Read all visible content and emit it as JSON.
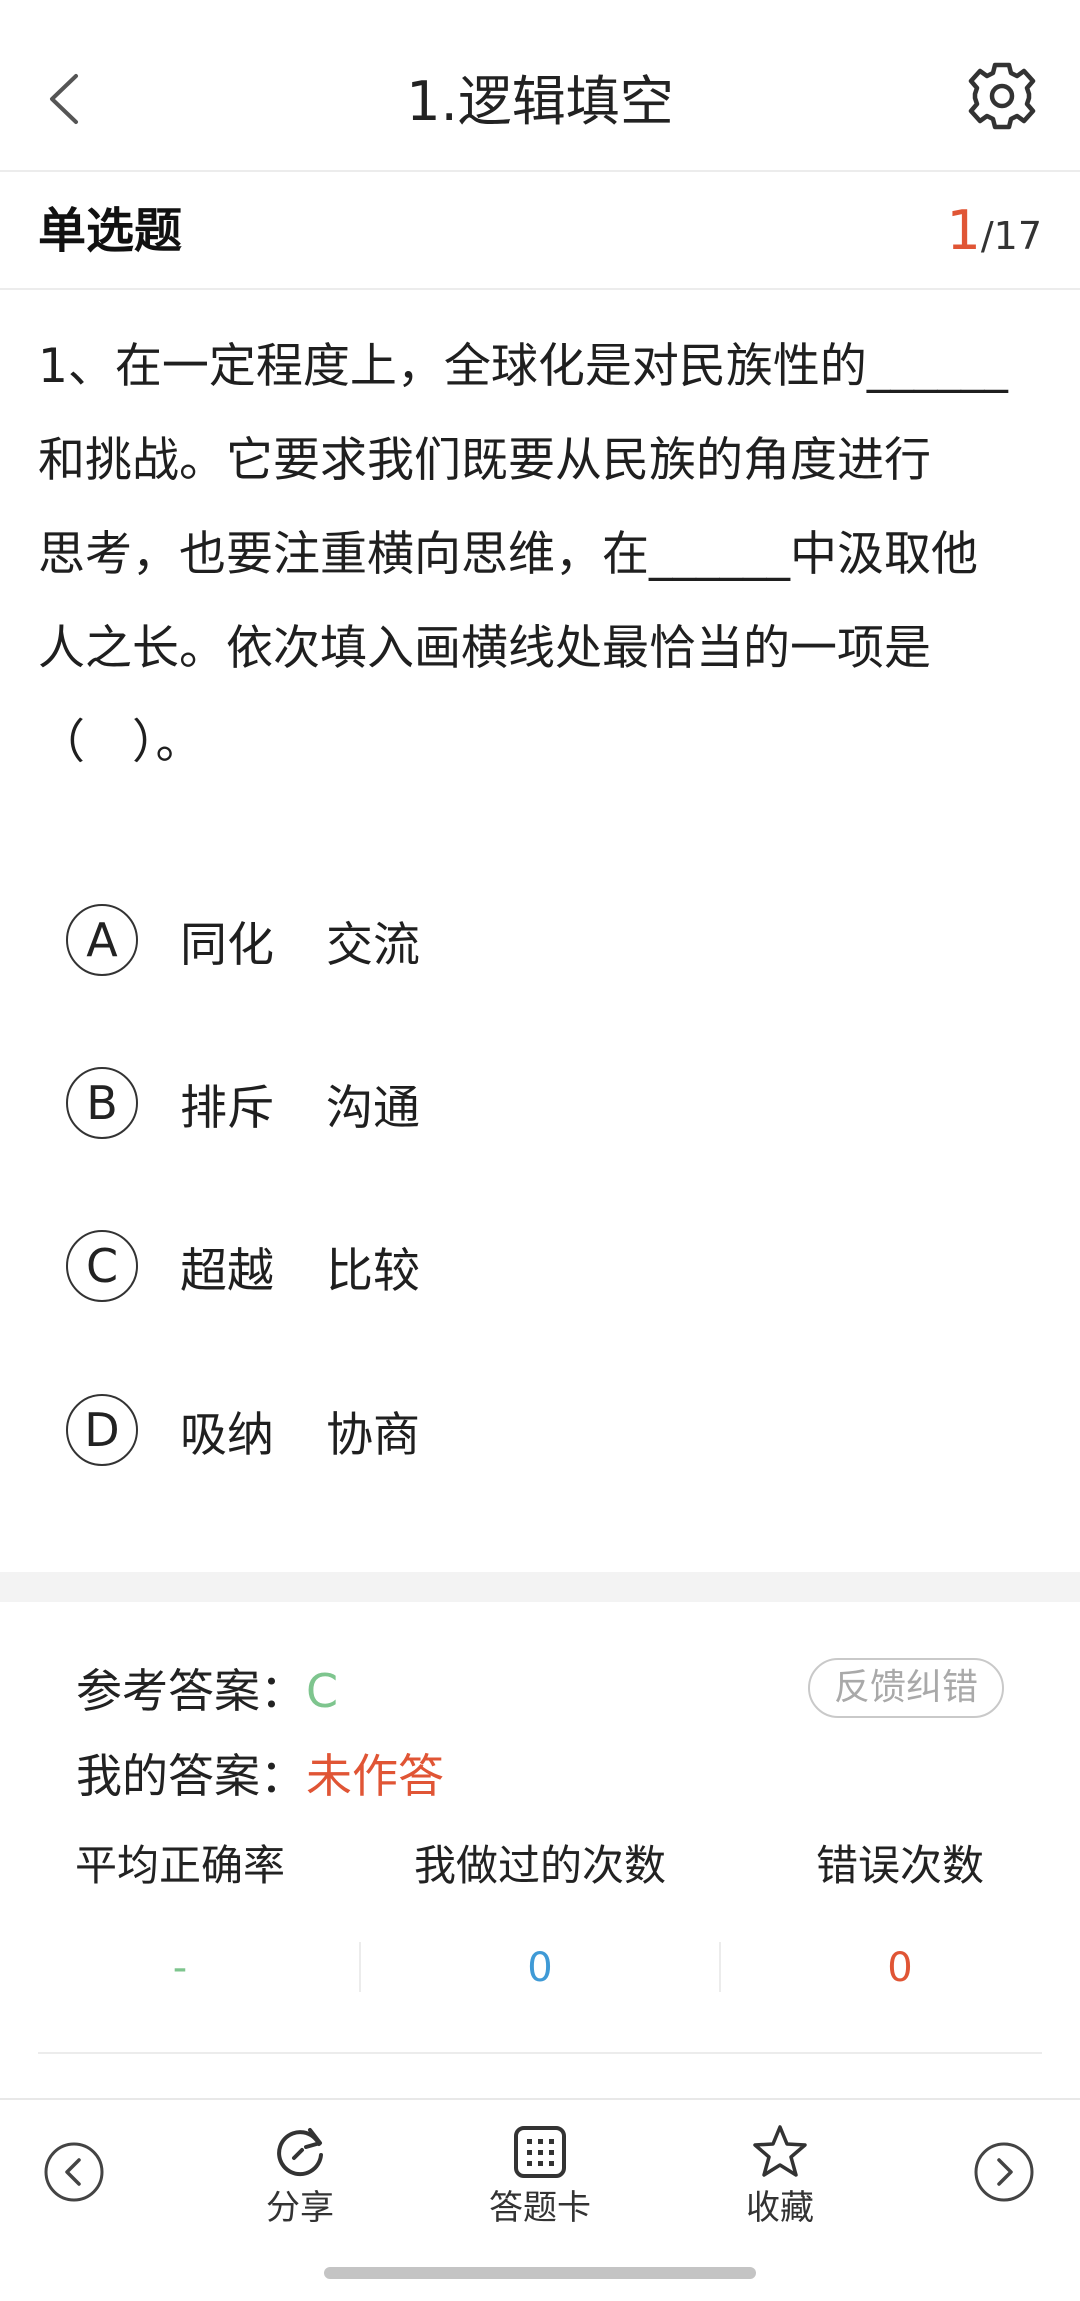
{
  "header": {
    "title": "1.逻辑填空"
  },
  "question_bar": {
    "type_label": "单选题",
    "current": "1",
    "total": "/17"
  },
  "question": {
    "line1": "1、在一定程度上，全球化是对民族性的______",
    "line2": "和挑战。它要求我们既要从民族的角度进行",
    "line3": "思考，也要注重横向思维，在______中汲取他",
    "line4": "人之长。依次填入画横线处最恰当的一项是",
    "line5": "（　）。"
  },
  "options": [
    {
      "letter": "A",
      "word1": "同化",
      "word2": "交流"
    },
    {
      "letter": "B",
      "word1": "排斥",
      "word2": "沟通"
    },
    {
      "letter": "C",
      "word1": "超越",
      "word2": "比较"
    },
    {
      "letter": "D",
      "word1": "吸纳",
      "word2": "协商"
    }
  ],
  "answer": {
    "ref_label": "参考答案：",
    "ref_value": "C",
    "my_label": "我的答案：",
    "my_value": "未作答",
    "feedback_label": "反馈纠错"
  },
  "stats": {
    "headers": [
      "平均正确率",
      "我做过的次数",
      "错误次数"
    ],
    "values": [
      "-",
      "0",
      "0"
    ],
    "colors": [
      "#7ec58e",
      "#3f9ad6",
      "#e05535"
    ]
  },
  "toolbar": {
    "share_label": "分享",
    "card_label": "答题卡",
    "fav_label": "收藏"
  },
  "icons": {
    "back": "chevron-left-icon",
    "settings": "gear-icon",
    "prev": "circle-chevron-left-icon",
    "next": "circle-chevron-right-icon",
    "share": "refresh-share-icon",
    "card": "grid-card-icon",
    "fav": "star-icon"
  }
}
